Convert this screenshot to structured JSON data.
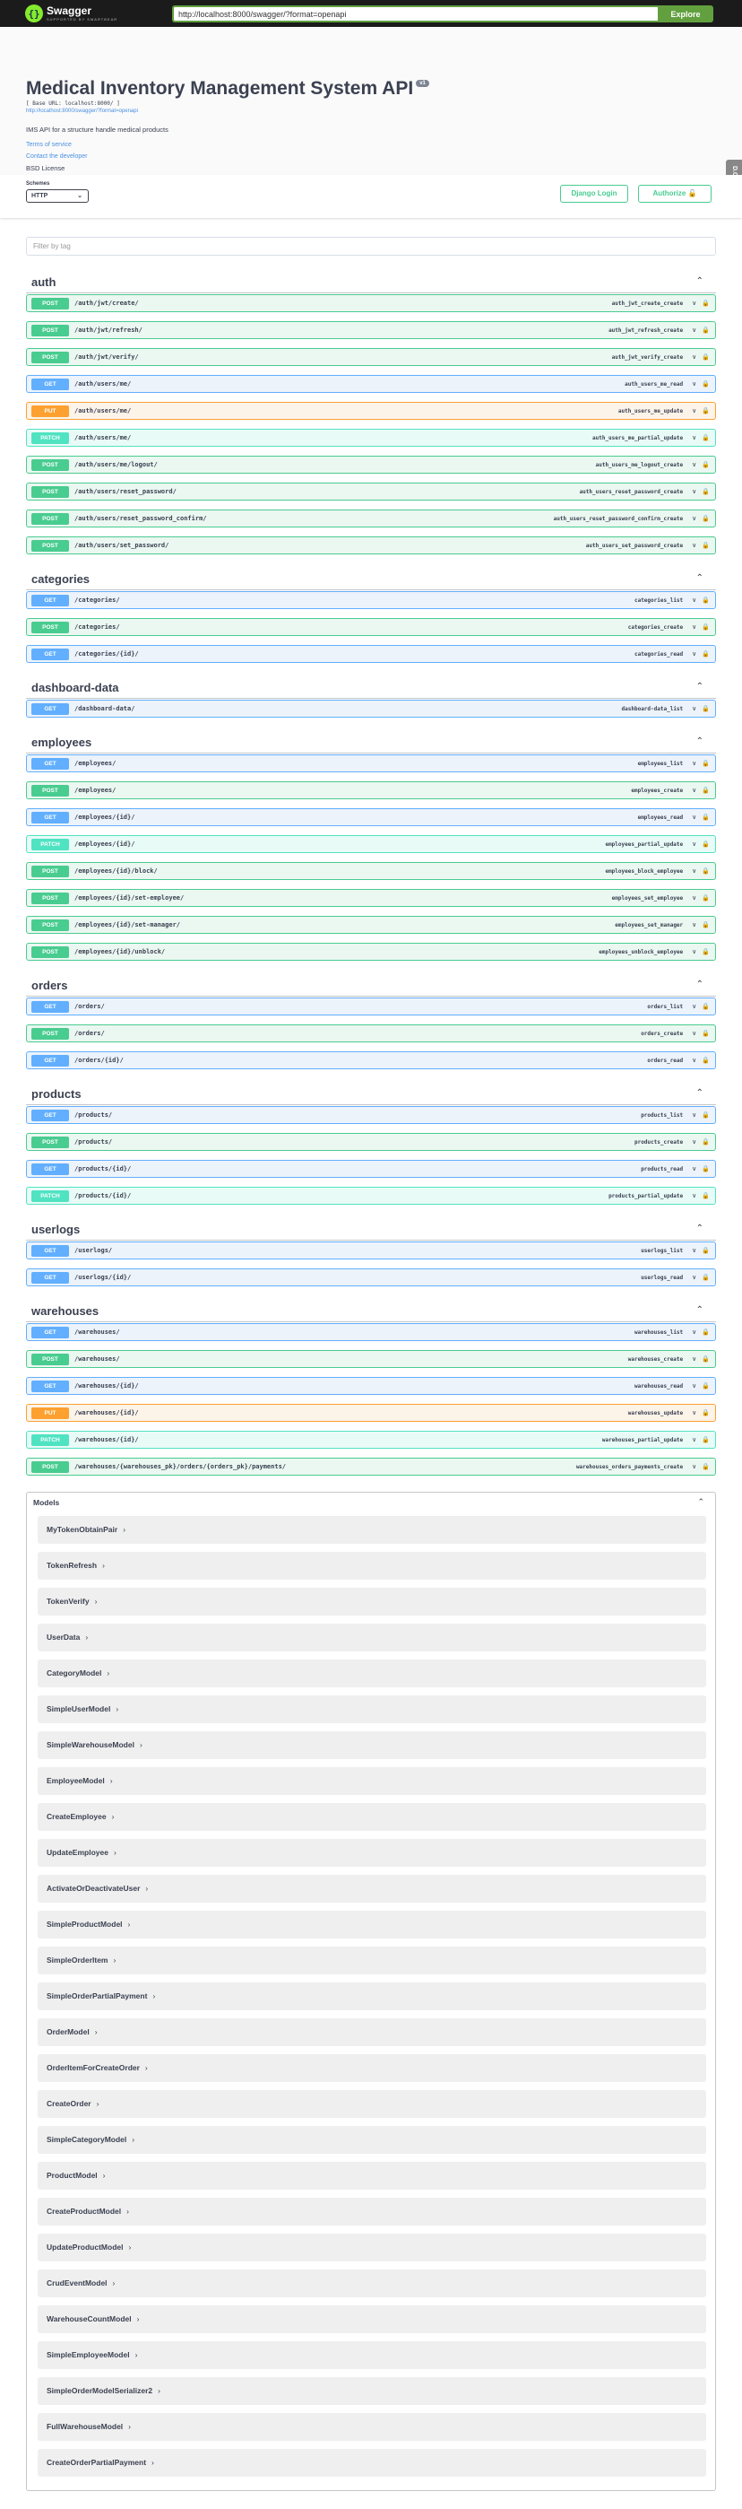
{
  "topbar": {
    "brand": "Swagger",
    "brand_sub": "SUPPORTED BY SMARTBEAR",
    "url": "http://localhost:8000/swagger/?format=openapi",
    "explore": "Explore"
  },
  "info": {
    "title": "Medical Inventory Management System API",
    "version": "v1",
    "base_url": "[ Base URL: localhost:8000/ ]",
    "openapi_link": "http://localhost:8000/swagger/?format=openapi",
    "description": "IMS API for a structure handle medical products",
    "terms": "Terms of service",
    "contact": "Contact the developer",
    "license": "BSD License"
  },
  "side_tab": "D.OT",
  "schemes": {
    "label": "Schemes",
    "value": "HTTP",
    "django_login": "Django Login",
    "authorize": "Authorize"
  },
  "filter_placeholder": "Filter by tag",
  "tags": [
    {
      "name": "auth",
      "ops": [
        {
          "method": "POST",
          "path": "/auth/jwt/create/",
          "id": "auth_jwt_create_create"
        },
        {
          "method": "POST",
          "path": "/auth/jwt/refresh/",
          "id": "auth_jwt_refresh_create"
        },
        {
          "method": "POST",
          "path": "/auth/jwt/verify/",
          "id": "auth_jwt_verify_create"
        },
        {
          "method": "GET",
          "path": "/auth/users/me/",
          "id": "auth_users_me_read"
        },
        {
          "method": "PUT",
          "path": "/auth/users/me/",
          "id": "auth_users_me_update"
        },
        {
          "method": "PATCH",
          "path": "/auth/users/me/",
          "id": "auth_users_me_partial_update"
        },
        {
          "method": "POST",
          "path": "/auth/users/me/logout/",
          "id": "auth_users_me_logout_create"
        },
        {
          "method": "POST",
          "path": "/auth/users/reset_password/",
          "id": "auth_users_reset_password_create"
        },
        {
          "method": "POST",
          "path": "/auth/users/reset_password_confirm/",
          "id": "auth_users_reset_password_confirm_create"
        },
        {
          "method": "POST",
          "path": "/auth/users/set_password/",
          "id": "auth_users_set_password_create"
        }
      ]
    },
    {
      "name": "categories",
      "ops": [
        {
          "method": "GET",
          "path": "/categories/",
          "id": "categories_list"
        },
        {
          "method": "POST",
          "path": "/categories/",
          "id": "categories_create"
        },
        {
          "method": "GET",
          "path": "/categories/{id}/",
          "id": "categories_read"
        }
      ]
    },
    {
      "name": "dashboard-data",
      "ops": [
        {
          "method": "GET",
          "path": "/dashboard-data/",
          "id": "dashboard-data_list"
        }
      ]
    },
    {
      "name": "employees",
      "ops": [
        {
          "method": "GET",
          "path": "/employees/",
          "id": "employees_list"
        },
        {
          "method": "POST",
          "path": "/employees/",
          "id": "employees_create"
        },
        {
          "method": "GET",
          "path": "/employees/{id}/",
          "id": "employees_read"
        },
        {
          "method": "PATCH",
          "path": "/employees/{id}/",
          "id": "employees_partial_update"
        },
        {
          "method": "POST",
          "path": "/employees/{id}/block/",
          "id": "employees_block_employee"
        },
        {
          "method": "POST",
          "path": "/employees/{id}/set-employee/",
          "id": "employees_set_employee"
        },
        {
          "method": "POST",
          "path": "/employees/{id}/set-manager/",
          "id": "employees_set_manager"
        },
        {
          "method": "POST",
          "path": "/employees/{id}/unblock/",
          "id": "employees_unblock_employee"
        }
      ]
    },
    {
      "name": "orders",
      "ops": [
        {
          "method": "GET",
          "path": "/orders/",
          "id": "orders_list"
        },
        {
          "method": "POST",
          "path": "/orders/",
          "id": "orders_create"
        },
        {
          "method": "GET",
          "path": "/orders/{id}/",
          "id": "orders_read"
        }
      ]
    },
    {
      "name": "products",
      "ops": [
        {
          "method": "GET",
          "path": "/products/",
          "id": "products_list"
        },
        {
          "method": "POST",
          "path": "/products/",
          "id": "products_create"
        },
        {
          "method": "GET",
          "path": "/products/{id}/",
          "id": "products_read"
        },
        {
          "method": "PATCH",
          "path": "/products/{id}/",
          "id": "products_partial_update"
        }
      ]
    },
    {
      "name": "userlogs",
      "ops": [
        {
          "method": "GET",
          "path": "/userlogs/",
          "id": "userlogs_list"
        },
        {
          "method": "GET",
          "path": "/userlogs/{id}/",
          "id": "userlogs_read"
        }
      ]
    },
    {
      "name": "warehouses",
      "ops": [
        {
          "method": "GET",
          "path": "/warehouses/",
          "id": "warehouses_list"
        },
        {
          "method": "POST",
          "path": "/warehouses/",
          "id": "warehouses_create"
        },
        {
          "method": "GET",
          "path": "/warehouses/{id}/",
          "id": "warehouses_read"
        },
        {
          "method": "PUT",
          "path": "/warehouses/{id}/",
          "id": "warehouses_update"
        },
        {
          "method": "PATCH",
          "path": "/warehouses/{id}/",
          "id": "warehouses_partial_update"
        },
        {
          "method": "POST",
          "path": "/warehouses/{warehouses_pk}/orders/{orders_pk}/payments/",
          "id": "warehouses_orders_payments_create"
        }
      ]
    }
  ],
  "models": {
    "title": "Models",
    "items": [
      "MyTokenObtainPair",
      "TokenRefresh",
      "TokenVerify",
      "UserData",
      "CategoryModel",
      "SimpleUserModel",
      "SimpleWarehouseModel",
      "EmployeeModel",
      "CreateEmployee",
      "UpdateEmployee",
      "ActivateOrDeactivateUser",
      "SimpleProductModel",
      "SimpleOrderItem",
      "SimpleOrderPartialPayment",
      "OrderModel",
      "OrderItemForCreateOrder",
      "CreateOrder",
      "SimpleCategoryModel",
      "ProductModel",
      "CreateProductModel",
      "UpdateProductModel",
      "CrudEventModel",
      "WarehouseCountModel",
      "SimpleEmployeeModel",
      "SimpleOrderModelSerializer2",
      "FullWarehouseModel",
      "CreateOrderPartialPayment"
    ]
  }
}
